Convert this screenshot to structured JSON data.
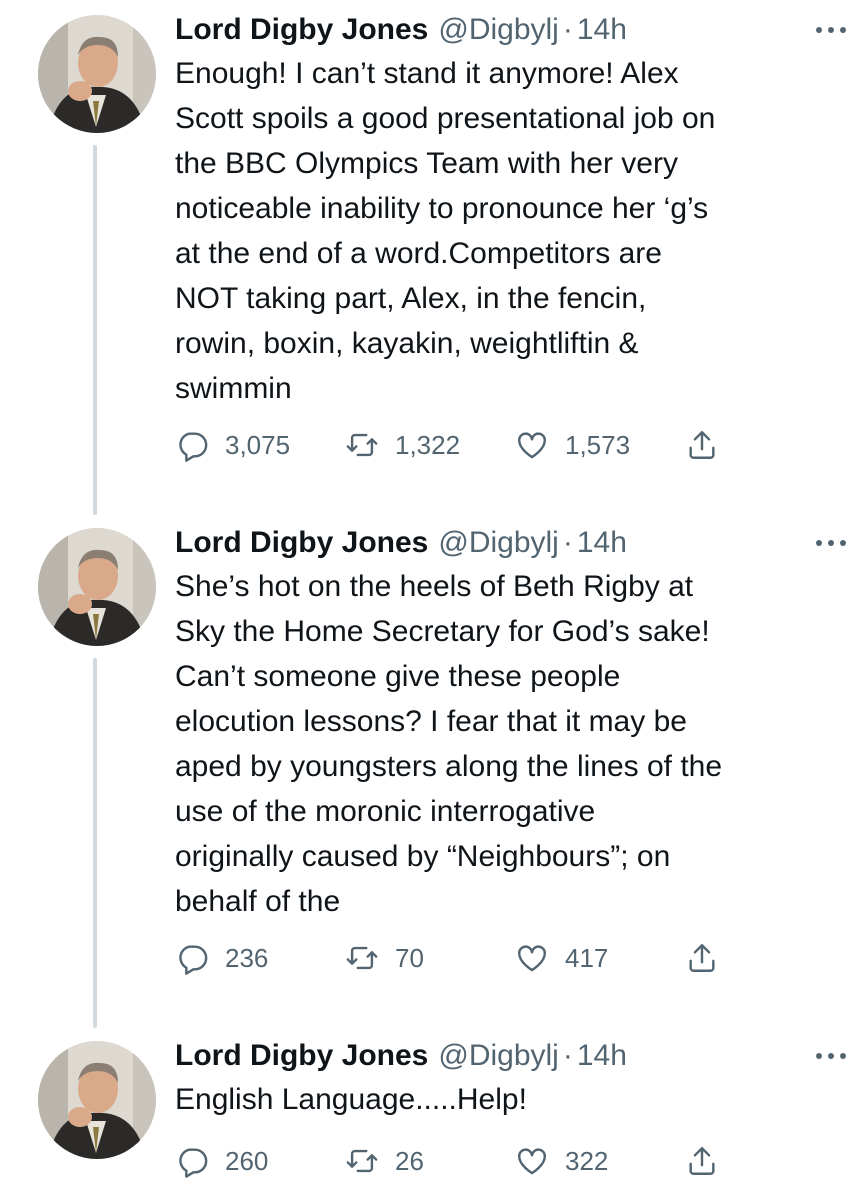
{
  "tweets": [
    {
      "name": "Lord Digby Jones",
      "handle": "@Digbylj",
      "separator": "·",
      "time": "14h",
      "lines": [
        "Enough! I can’t stand it anymore! Alex",
        "Scott spoils a good presentational job on",
        "the BBC Olympics Team with her very",
        "noticeable inability to pronounce her ‘g’s",
        "at the end of a word.Competitors are",
        "NOT taking part, Alex, in the fencin,",
        "rowin, boxin, kayakin, weightliftin &",
        "swimmin"
      ],
      "replies": "3,075",
      "retweets": "1,322",
      "likes": "1,573"
    },
    {
      "name": "Lord Digby Jones",
      "handle": "@Digbylj",
      "separator": "·",
      "time": "14h",
      "lines": [
        "She’s hot on the heels of Beth Rigby at",
        "Sky the Home Secretary for God’s sake!",
        "Can’t someone give these people",
        "elocution lessons? I fear that it may be",
        "aped by youngsters along the lines of the",
        "use of the moronic interrogative",
        "originally caused by “Neighbours”; on",
        "behalf of the"
      ],
      "replies": "236",
      "retweets": "70",
      "likes": "417"
    },
    {
      "name": "Lord Digby Jones",
      "handle": "@Digbylj",
      "separator": "·",
      "time": "14h",
      "lines": [
        "English Language.....Help!"
      ],
      "replies": "260",
      "retweets": "26",
      "likes": "322"
    }
  ],
  "icons": {
    "more": "more-horizontal-icon",
    "reply": "reply-icon",
    "retweet": "retweet-icon",
    "like": "like-icon",
    "share": "share-icon"
  },
  "colors": {
    "text": "#0f1419",
    "secondary": "#536471",
    "thread_line": "#cfd9de"
  }
}
